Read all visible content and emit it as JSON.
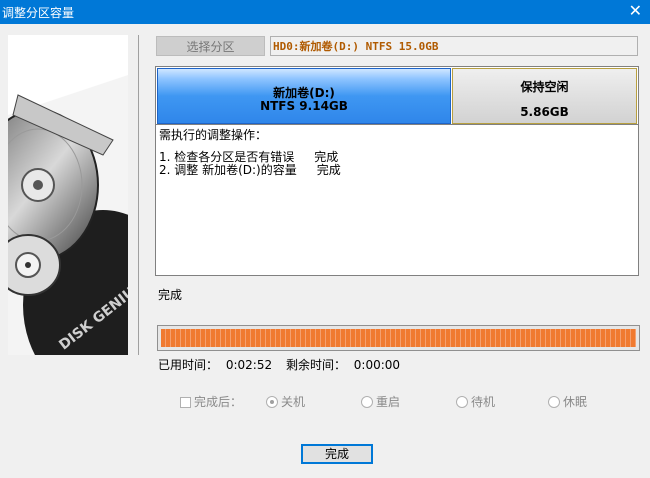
{
  "window": {
    "title": "调整分区容量",
    "close_glyph": "✕"
  },
  "sidebar": {
    "logo_text": "DISK GENIUS"
  },
  "toolbar": {
    "select_partition_label": "选择分区"
  },
  "disk": {
    "label": "HD0:新加卷(D:) NTFS 15.0GB"
  },
  "partition_map": {
    "main": {
      "name": "新加卷(D:)",
      "info": "NTFS 9.14GB"
    },
    "free": {
      "name": "保持空闲",
      "size": "5.86GB"
    }
  },
  "operations": {
    "title": "需执行的调整操作：",
    "items": [
      {
        "text": "1. 检查各分区是否有错误",
        "status": "完成"
      },
      {
        "text": "2. 调整 新加卷(D:)的容量",
        "status": "完成"
      }
    ]
  },
  "status": {
    "text": "完成"
  },
  "progress": {
    "value": 1.0
  },
  "time": {
    "elapsed_label": "已用时间：",
    "elapsed": "0:02:52",
    "remaining_label": "剩余时间：",
    "remaining": "0:00:00"
  },
  "after": {
    "checkbox_label": "完成后：",
    "options": [
      {
        "label": "关机",
        "selected": true
      },
      {
        "label": "重启",
        "selected": false
      },
      {
        "label": "待机",
        "selected": false
      },
      {
        "label": "休眠",
        "selected": false
      }
    ]
  },
  "buttons": {
    "finish_label": "完成"
  },
  "colors": {
    "title_bar": "#0078d7",
    "partition_blue": "#3f97f2",
    "progress_orange": "#f07a30",
    "disk_label": "#b05a00"
  }
}
